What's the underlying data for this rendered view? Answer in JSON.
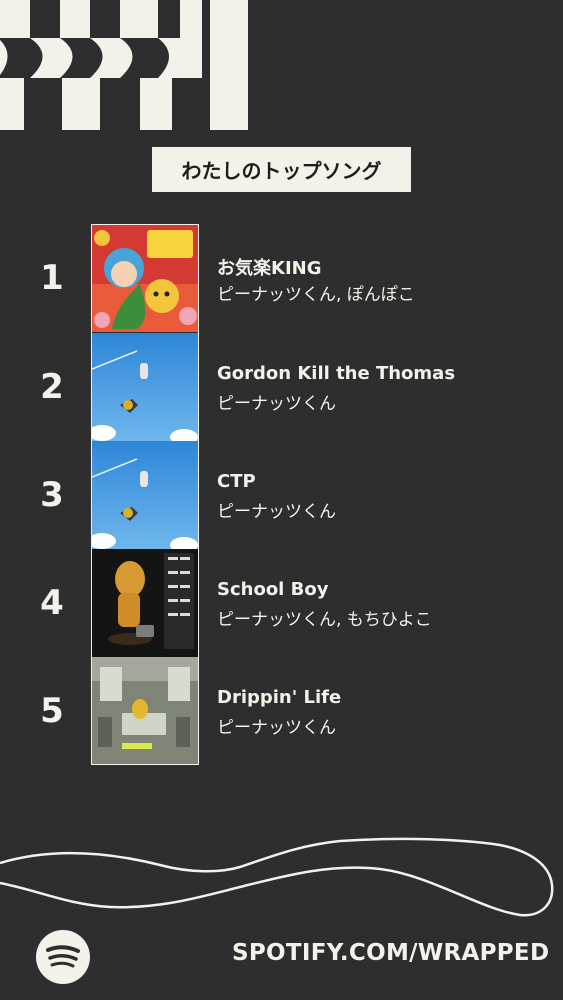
{
  "header": {
    "title": "わたしのトップソング"
  },
  "tracks": [
    {
      "rank": "1",
      "title": "お気楽KING",
      "artist": "ピーナッツくん, ぽんぽこ"
    },
    {
      "rank": "2",
      "title": "Gordon Kill the Thomas",
      "artist": "ピーナッツくん"
    },
    {
      "rank": "3",
      "title": "CTP",
      "artist": "ピーナッツくん"
    },
    {
      "rank": "4",
      "title": "School Boy",
      "artist": "ピーナッツくん, もちひよこ"
    },
    {
      "rank": "5",
      "title": "Drippin' Life",
      "artist": "ピーナッツくん"
    }
  ],
  "footer": {
    "url": "SPOTIFY.COM/WRAPPED",
    "logo_icon": "spotify-logo-icon"
  },
  "colors": {
    "background": "#2e2e2e",
    "cream": "#f4f1ea",
    "dark_text": "#1e1e1e"
  }
}
